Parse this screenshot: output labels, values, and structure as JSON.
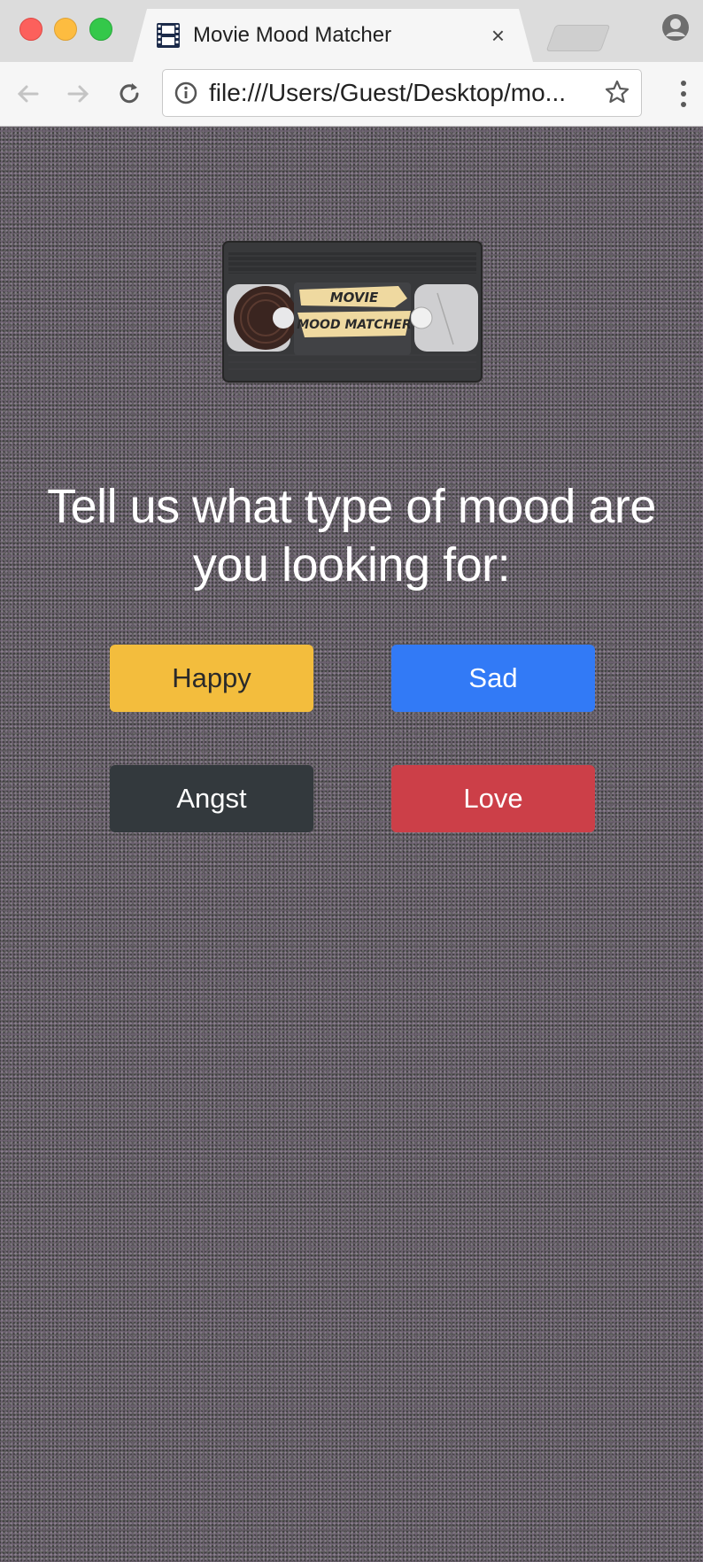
{
  "browser": {
    "tab_title": "Movie Mood Matcher",
    "tab_close": "×",
    "url": "file:///Users/Guest/Desktop/mo..."
  },
  "logo": {
    "line1": "MOVIE",
    "line2": "MOOD MATCHER"
  },
  "page": {
    "prompt": "Tell us what type of mood are you looking for:",
    "moods": [
      {
        "label": "Happy",
        "color": "#f3bd3d"
      },
      {
        "label": "Sad",
        "color": "#327af6"
      },
      {
        "label": "Angst",
        "color": "#33393d"
      },
      {
        "label": "Love",
        "color": "#cc3f48"
      }
    ]
  }
}
